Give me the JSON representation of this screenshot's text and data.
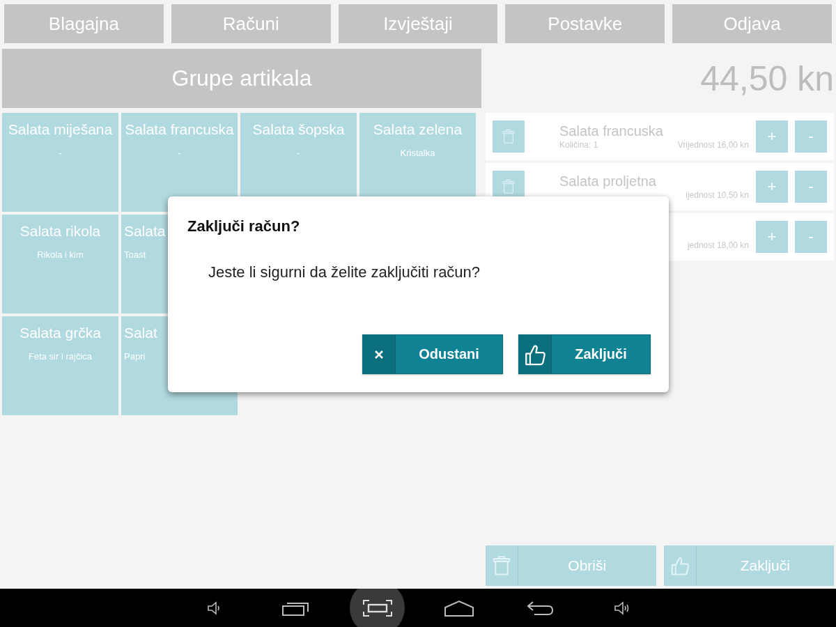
{
  "nav": [
    {
      "label": "Blagajna"
    },
    {
      "label": "Računi"
    },
    {
      "label": "Izvještaji"
    },
    {
      "label": "Postavke"
    },
    {
      "label": "Odjava"
    }
  ],
  "groups_header": "Grupe artikala",
  "total": "44,50 kn",
  "tile_rows": [
    [
      {
        "name": "Salata miješana",
        "desc": "-",
        "kind": "full"
      },
      {
        "name": "Salata francuska",
        "desc": "-",
        "kind": "full"
      },
      {
        "name": "Salata šopska",
        "desc": "-",
        "kind": "full"
      },
      {
        "name": "Salata zelena",
        "desc": "Kristalka",
        "kind": "full"
      }
    ],
    [
      {
        "name": "Salata rikola",
        "desc": "Rikola i kim",
        "kind": "full"
      },
      {
        "name": "Salata",
        "desc": "Toast",
        "kind": "covered"
      }
    ],
    [
      {
        "name": "Salata grčka",
        "desc": "Feta sir i rajčica",
        "kind": "full"
      },
      {
        "name": "Salat",
        "desc": "Papri",
        "kind": "covered"
      }
    ]
  ],
  "bill_items": [
    {
      "name": "Salata francuska",
      "quantity": "Količina: 1",
      "value": "Vrijednost 16,00 kn",
      "trash": true,
      "plus": "+",
      "minus": "-"
    },
    {
      "name": "Salata proljetna",
      "value": "ijednost 10,50 kn",
      "trash": true,
      "plus": "+",
      "minus": "-"
    },
    {
      "value": "jednost 18,00 kn",
      "trash": false,
      "plus": "+",
      "minus": "-"
    }
  ],
  "actions": [
    {
      "label": "Obriši",
      "kind": "delete"
    },
    {
      "label": "Zaključi",
      "kind": "confirm"
    }
  ],
  "dialog": {
    "title": "Zaključi račun?",
    "message": "Jeste li sigurni da želite zaključiti račun?",
    "buttons": [
      {
        "label": "Odustani",
        "kind": "cancel"
      },
      {
        "label": "Zaključi",
        "kind": "confirm"
      }
    ]
  },
  "system_bar": [
    {
      "kind": "volume-down",
      "selected": false
    },
    {
      "kind": "recents",
      "selected": false
    },
    {
      "kind": "screenshot",
      "selected": true
    },
    {
      "kind": "home",
      "selected": false
    },
    {
      "kind": "back",
      "selected": false
    },
    {
      "kind": "volume-up",
      "selected": false
    }
  ]
}
